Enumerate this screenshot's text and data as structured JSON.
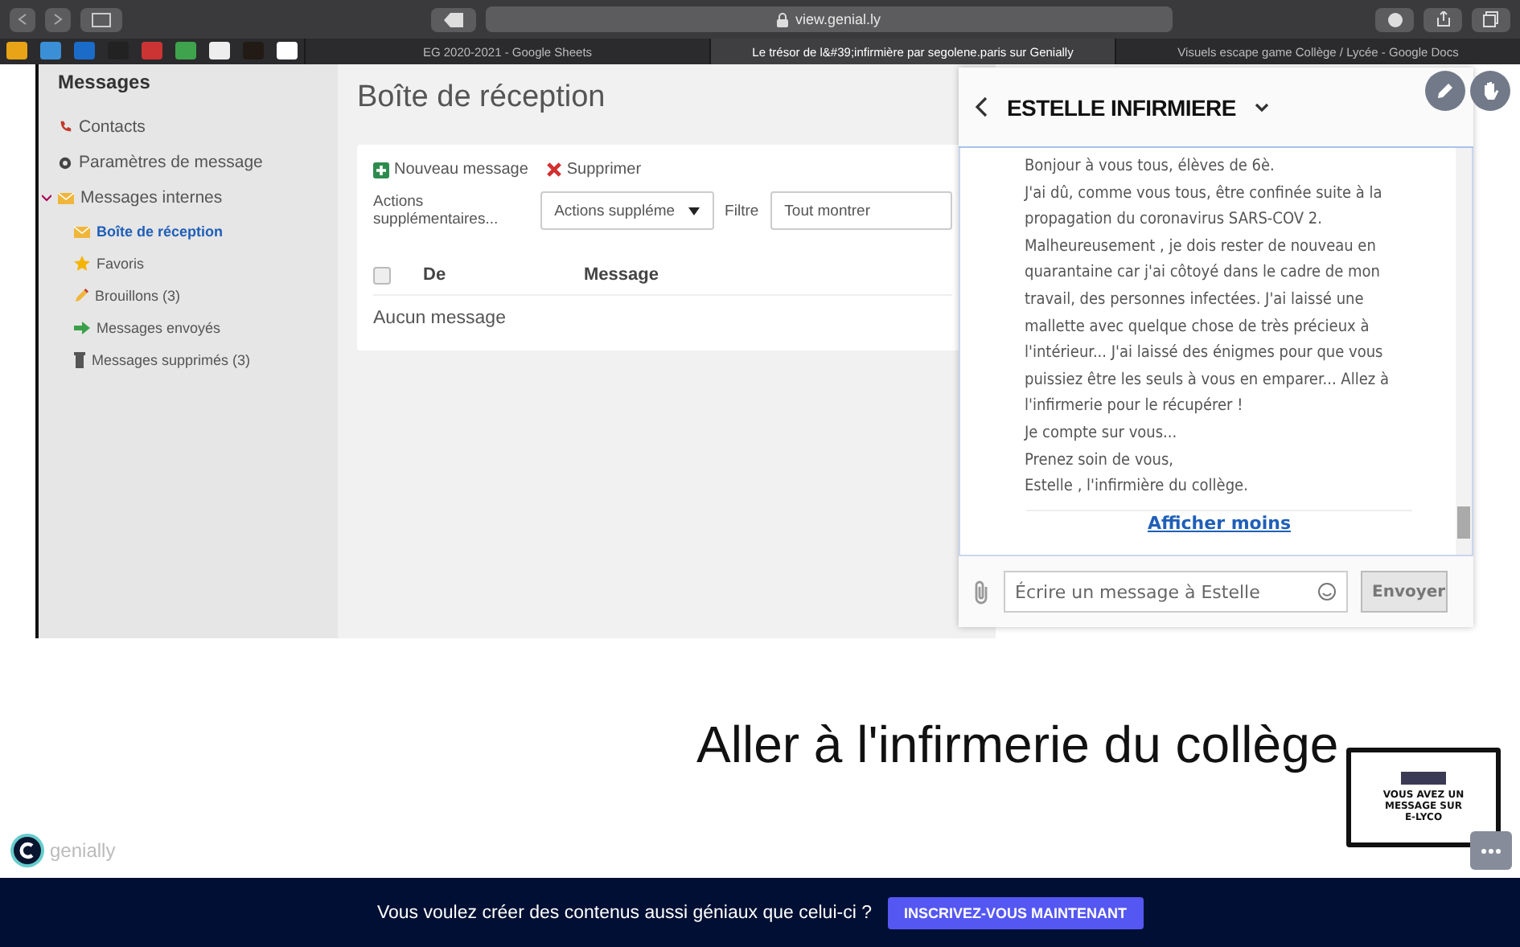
{
  "browser": {
    "address": "view.genial.ly",
    "tabs": [
      {
        "label": "EG 2020-2021 - Google Sheets",
        "selected": false
      },
      {
        "label": "Le trésor de l&#39;infirmière par segolene.paris sur Genially",
        "selected": true
      },
      {
        "label": "Visuels escape game Collège / Lycée - Google Docs",
        "selected": false
      }
    ]
  },
  "sidebar": {
    "title": "Messages",
    "items": [
      {
        "label": "Contacts",
        "kind": "phone",
        "selected": false
      },
      {
        "label": "Paramètres de message",
        "kind": "gear",
        "selected": false
      },
      {
        "label": "Messages internes",
        "kind": "mail",
        "selected": false,
        "expanded": true,
        "children": [
          {
            "label": "Boîte de réception",
            "kind": "mail",
            "selected": true
          },
          {
            "label": "Favoris",
            "kind": "star",
            "selected": false
          },
          {
            "label": "Brouillons (3)",
            "kind": "pencil",
            "selected": false
          },
          {
            "label": "Messages envoyés",
            "kind": "arrow",
            "selected": false
          },
          {
            "label": "Messages supprimés (3)",
            "kind": "trash",
            "selected": false
          }
        ]
      }
    ]
  },
  "inbox": {
    "title": "Boîte de réception",
    "actions": [
      {
        "label": "Nouveau message",
        "kind": "add"
      },
      {
        "label": "Supprimer",
        "kind": "delete"
      }
    ],
    "more_label": "Actions supplémentaires...",
    "more_select": "Actions suppléme",
    "filter_label": "Filtre",
    "filter_value": "Tout montrer",
    "columns": [
      "De",
      "Message"
    ],
    "select_all_checked": false,
    "empty": "Aucun message"
  },
  "chat": {
    "title": "ESTELLE INFIRMIERE",
    "lines": [
      "Bonjour à vous tous, élèves de 6è.",
      "J'ai dû, comme vous tous, être confinée suite à la propagation du coronavirus SARS-COV 2. Malheureusement , je dois rester de nouveau en quarantaine car j'ai côtoyé dans le cadre de mon travail, des personnes infectées. J'ai laissé une mallette avec quelque chose de très précieux à l'intérieur... J'ai laissé des énigmes pour que vous puissiez être les seuls à vous en emparer... Allez à l'infirmerie pour le récupérer !",
      "Je compte sur vous...",
      "Prenez soin de vous,",
      "Estelle , l'infirmière du collège."
    ],
    "toggle": "Afficher moins",
    "placeholder": "Écrire un message à Estelle",
    "send": "Envoyer"
  },
  "heading": "Aller à l'infirmerie du collège",
  "thumbnail": {
    "text": "VOUS AVEZ UN MESSAGE SUR E-LYCO"
  },
  "logo": "genially",
  "banner": {
    "text": "Vous voulez créer des contenus aussi géniaux que celui-ci ?",
    "button": "INSCRIVEZ-VOUS MAINTENANT"
  }
}
